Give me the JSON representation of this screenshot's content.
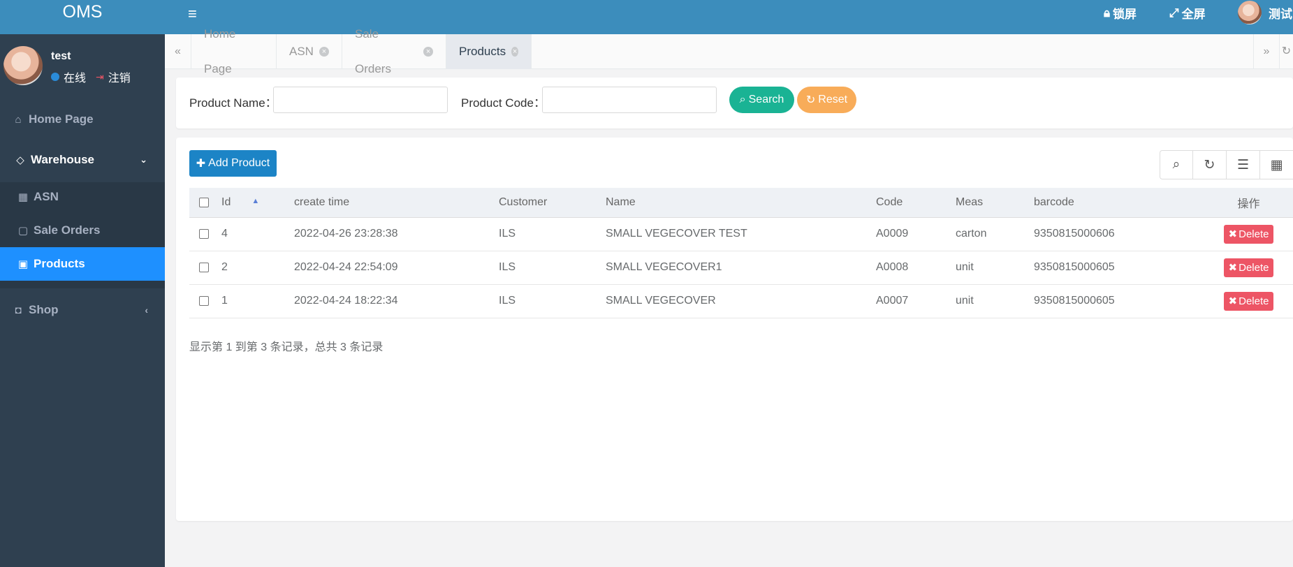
{
  "app": {
    "brand": "OMS"
  },
  "profile": {
    "name": "test",
    "status": "在线",
    "logout": "注销"
  },
  "sidebar": {
    "home": "Home Page",
    "warehouse": "Warehouse",
    "asn": "ASN",
    "sale_orders": "Sale Orders",
    "products": "Products",
    "shop": "Shop"
  },
  "topbar": {
    "lock": "锁屏",
    "fullscreen": "全屏",
    "user": "测试"
  },
  "tabs": [
    {
      "label": "Home Page",
      "closable": false
    },
    {
      "label": "ASN",
      "closable": true
    },
    {
      "label": "Sale Orders",
      "closable": true
    },
    {
      "label": "Products",
      "closable": true,
      "active": true
    }
  ],
  "search": {
    "product_name_label": "Product Name：",
    "product_name_value": "",
    "product_code_label": "Product Code：",
    "product_code_value": "",
    "search_button": "Search",
    "reset_button": "Reset"
  },
  "table": {
    "add_button": "Add Product",
    "columns": [
      "Id",
      "create time",
      "Customer",
      "Name",
      "Code",
      "Meas",
      "barcode",
      "操作"
    ],
    "rows": [
      {
        "id": "4",
        "create_time": "2022-04-26 23:28:38",
        "customer": "ILS",
        "name": "SMALL VEGECOVER TEST",
        "code": "A0009",
        "meas": "carton",
        "barcode": "9350815000606",
        "action": "Delete"
      },
      {
        "id": "2",
        "create_time": "2022-04-24 22:54:09",
        "customer": "ILS",
        "name": "SMALL VEGECOVER1",
        "code": "A0008",
        "meas": "unit",
        "barcode": "9350815000605",
        "action": "Delete"
      },
      {
        "id": "1",
        "create_time": "2022-04-24 18:22:34",
        "customer": "ILS",
        "name": "SMALL VEGECOVER",
        "code": "A0007",
        "meas": "unit",
        "barcode": "9350815000605",
        "action": "Delete"
      }
    ],
    "pagination_info": "显示第 1 到第 3 条记录，总共 3 条记录"
  },
  "colors": {
    "topbar": "#3c8dbc",
    "sidebar": "#2f4050",
    "active_menu": "#1e90ff",
    "search_btn": "#1ab394",
    "reset_btn": "#f8ac59",
    "add_btn": "#1c84c6",
    "delete_btn": "#ed5565"
  }
}
